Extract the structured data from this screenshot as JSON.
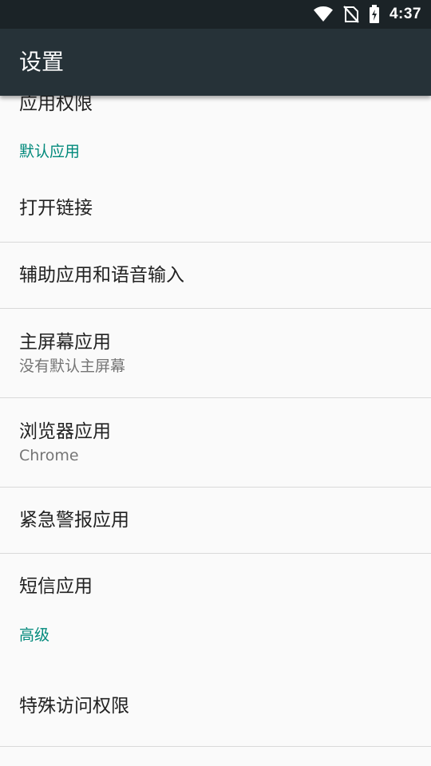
{
  "status_bar": {
    "time": "4:37",
    "icons": [
      "wifi-icon",
      "no-sim-icon",
      "battery-charging-icon"
    ]
  },
  "app_bar": {
    "title": "设置"
  },
  "list": {
    "app_permissions": {
      "title": "应用权限"
    },
    "default_apps_header": "默认应用",
    "open_links": {
      "title": "打开链接"
    },
    "assist_voice": {
      "title": "辅助应用和语音输入"
    },
    "home_app": {
      "title": "主屏幕应用",
      "summary": "没有默认主屏幕"
    },
    "browser_app": {
      "title": "浏览器应用",
      "summary": "Chrome"
    },
    "emergency_alerts": {
      "title": "紧急警报应用"
    },
    "sms_app": {
      "title": "短信应用"
    },
    "advanced_header": "高级",
    "special_access": {
      "title": "特殊访问权限"
    }
  },
  "colors": {
    "status_bar": "#1b2327",
    "app_bar": "#263238",
    "background": "#fafafa",
    "accent": "#00897b",
    "primary_text": "#212121",
    "secondary_text": "#757575",
    "divider": "#d9d9d9"
  }
}
